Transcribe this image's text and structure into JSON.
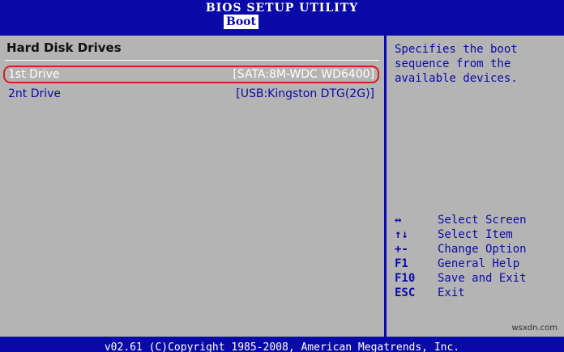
{
  "header": {
    "title": "BIOS SETUP UTILITY",
    "active_tab": "Boot"
  },
  "left_panel": {
    "section_title": "Hard Disk Drives",
    "drives": [
      {
        "label": "1st Drive",
        "value": "[SATA:8M-WDC WD6400]"
      },
      {
        "label": "2nt Drive",
        "value": "[USB:Kingston DTG(2G)]"
      }
    ]
  },
  "right_panel": {
    "help_text": "Specifies the boot\nsequence from the\navailable devices.",
    "keys": [
      {
        "key": "↔",
        "desc": "Select Screen"
      },
      {
        "key": "↑↓",
        "desc": "Select Item"
      },
      {
        "key": "+-",
        "desc": "Change Option"
      },
      {
        "key": "F1",
        "desc": "General Help"
      },
      {
        "key": "F10",
        "desc": "Save and Exit"
      },
      {
        "key": "ESC",
        "desc": "Exit"
      }
    ]
  },
  "footer": {
    "text": "v02.61 (C)Copyright 1985-2008, American Megatrends, Inc."
  },
  "watermark": "wsxdn.com",
  "colors": {
    "background": "#0a0aa8",
    "panel": "#b4b4b4",
    "highlight_border": "#d21f1f"
  }
}
